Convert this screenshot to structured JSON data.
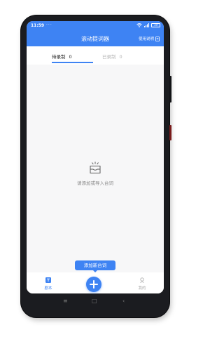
{
  "colors": {
    "accent": "#3e83f3",
    "screen_bg": "#f7f7f8",
    "phone_frame": "#1b1c20",
    "inactive_text": "#b4b4b4"
  },
  "status_bar": {
    "time": "11:59",
    "dots": "···",
    "battery": "19",
    "icons": [
      "wifi-icon",
      "signal-icon",
      "battery-icon"
    ]
  },
  "app_bar": {
    "title": "滚动提词器",
    "help_label": "使用说明",
    "help_icon": "document-icon"
  },
  "tabs": [
    {
      "label": "待录制",
      "count": "0",
      "active": true
    },
    {
      "label": "已录制",
      "count": "0",
      "active": false
    }
  ],
  "empty_state": {
    "icon": "inbox-icon",
    "message": "请添加或导入台词"
  },
  "add_tooltip": "添加新台词",
  "bottom_nav": {
    "script": {
      "label": "剧本",
      "icon": "script-icon",
      "active": true
    },
    "fab_icon": "plus-icon",
    "mine": {
      "label": "我的",
      "icon": "profile-icon",
      "active": false
    }
  },
  "system_nav": {
    "menu_icon": "≡",
    "home_icon": "□",
    "back_icon": "‹"
  }
}
